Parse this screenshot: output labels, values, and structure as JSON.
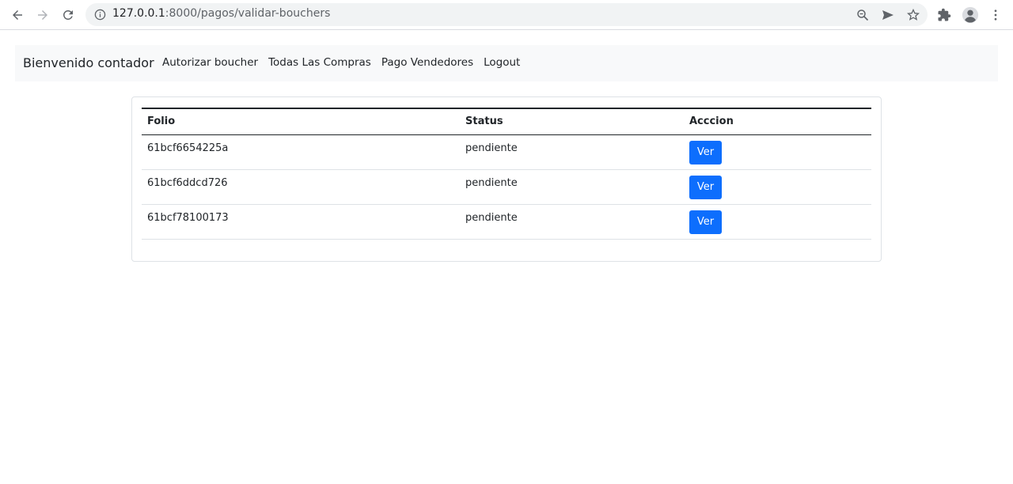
{
  "browser": {
    "url_host": "127.0.0.1",
    "url_path": ":8000/pagos/validar-bouchers"
  },
  "navbar": {
    "brand": "Bienvenido contador",
    "links": [
      {
        "label": "Autorizar boucher"
      },
      {
        "label": "Todas Las Compras"
      },
      {
        "label": "Pago Vendedores"
      },
      {
        "label": "Logout"
      }
    ]
  },
  "table": {
    "headers": [
      "Folio",
      "Status",
      "Acccion"
    ],
    "rows": [
      {
        "folio": "61bcf6654225a",
        "status": "pendiente",
        "action": "Ver"
      },
      {
        "folio": "61bcf6ddcd726",
        "status": "pendiente",
        "action": "Ver"
      },
      {
        "folio": "61bcf78100173",
        "status": "pendiente",
        "action": "Ver"
      }
    ]
  },
  "colors": {
    "primary_button": "#0d6efd",
    "navbar_bg": "#f8f9fa"
  },
  "icons": {
    "back": "arrow-left-icon",
    "forward": "arrow-right-icon",
    "reload": "reload-icon",
    "site_info": "info-icon",
    "zoom": "zoom-icon",
    "send": "send-icon",
    "bookmark": "star-icon",
    "extensions": "puzzle-icon",
    "profile": "avatar-icon",
    "menu": "kebab-menu-icon"
  }
}
